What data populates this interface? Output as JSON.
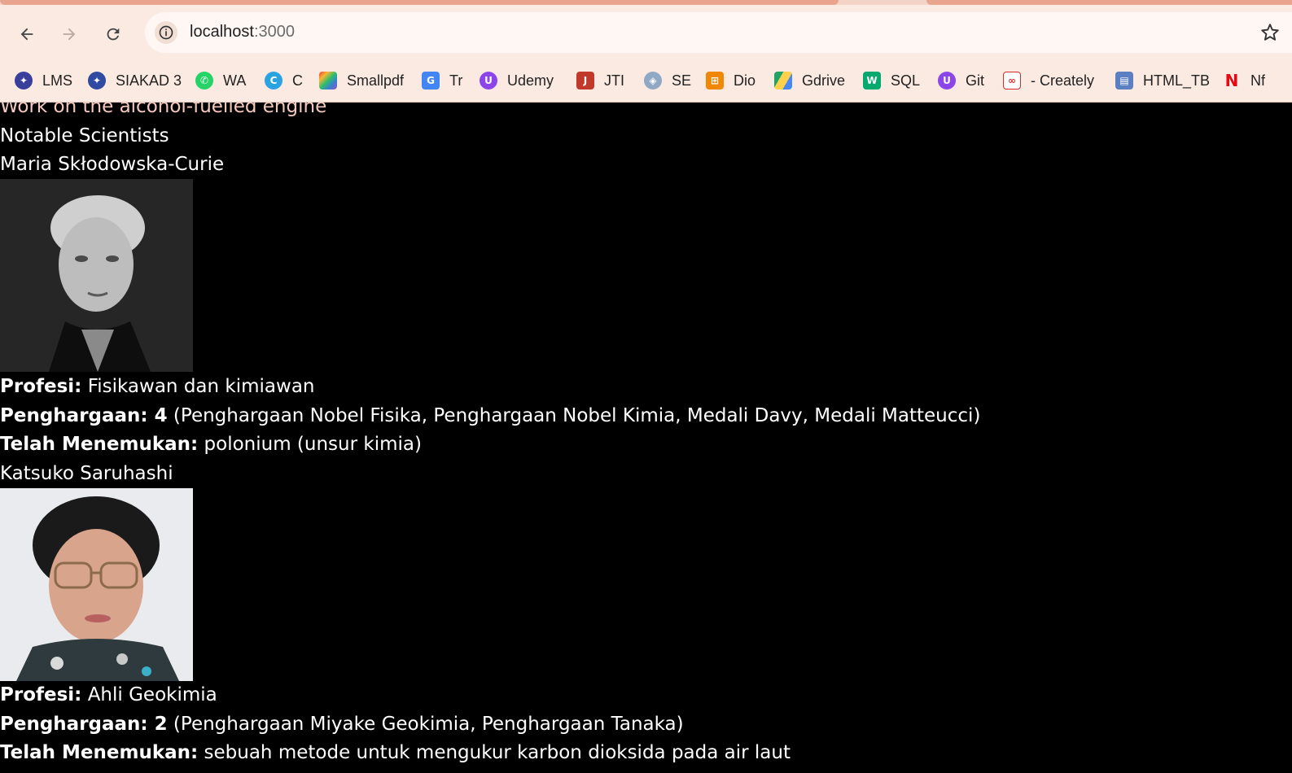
{
  "browser": {
    "url_host": "localhost",
    "url_port": ":3000",
    "bookmarks": [
      {
        "label": "LMS",
        "icon": "campus-crest-icon",
        "color": "#3b3f9c"
      },
      {
        "label": "SIAKAD 3",
        "icon": "campus-crest-icon",
        "color": "#2f4aa0"
      },
      {
        "label": "WA",
        "icon": "whatsapp-icon",
        "color": "#25d366"
      },
      {
        "label": "C",
        "icon": "canva-icon",
        "color": "#2aa3e0"
      },
      {
        "label": "Smallpdf",
        "icon": "smallpdf-icon",
        "color": "#ee3b3b"
      },
      {
        "label": "Tr",
        "icon": "translate-icon",
        "color": "#4285f4"
      },
      {
        "label": "Udemy",
        "icon": "udemy-icon",
        "color": "#8b45e8"
      },
      {
        "label": "JTI",
        "icon": "jti-icon",
        "color": "#c0392b"
      },
      {
        "label": "SE",
        "icon": "se-icon",
        "color": "#8fa9c4"
      },
      {
        "label": "Dio",
        "icon": "diagrams-icon",
        "color": "#f08705"
      },
      {
        "label": "Gdrive",
        "icon": "google-drive-icon",
        "color": "#1fa463"
      },
      {
        "label": "SQL",
        "icon": "w3schools-icon",
        "color": "#04aa6d"
      },
      {
        "label": "Git",
        "icon": "udemy-icon",
        "color": "#8b45e8"
      },
      {
        "label": "- Creately",
        "icon": "creately-icon",
        "color": "#d62b2b"
      },
      {
        "label": "HTML_TB",
        "icon": "book-icon",
        "color": "#5b7fc1"
      },
      {
        "label": "Nf",
        "icon": "netflix-icon",
        "color": "#e50914"
      }
    ]
  },
  "page": {
    "cut_heading": "Work on the alcohol-fuelled engine",
    "section_title": "Notable Scientists",
    "scientists": [
      {
        "name": "Maria Skłodowska-Curie",
        "profession_label": "Profesi:",
        "profession": " Fisikawan dan kimiawan",
        "awards_label": "Penghargaan: 4",
        "awards": " (Penghargaan Nobel Fisika, Penghargaan Nobel Kimia, Medali Davy, Medali Matteucci)",
        "discovered_label": "Telah Menemukan:",
        "discovered": " polonium (unsur kimia)"
      },
      {
        "name": "Katsuko Saruhashi",
        "profession_label": "Profesi:",
        "profession": " Ahli Geokimia",
        "awards_label": "Penghargaan: 2",
        "awards": " (Penghargaan Miyake Geokimia, Penghargaan Tanaka)",
        "discovered_label": "Telah Menemukan:",
        "discovered": " sebuah metode untuk mengukur karbon dioksida pada air laut"
      }
    ]
  }
}
